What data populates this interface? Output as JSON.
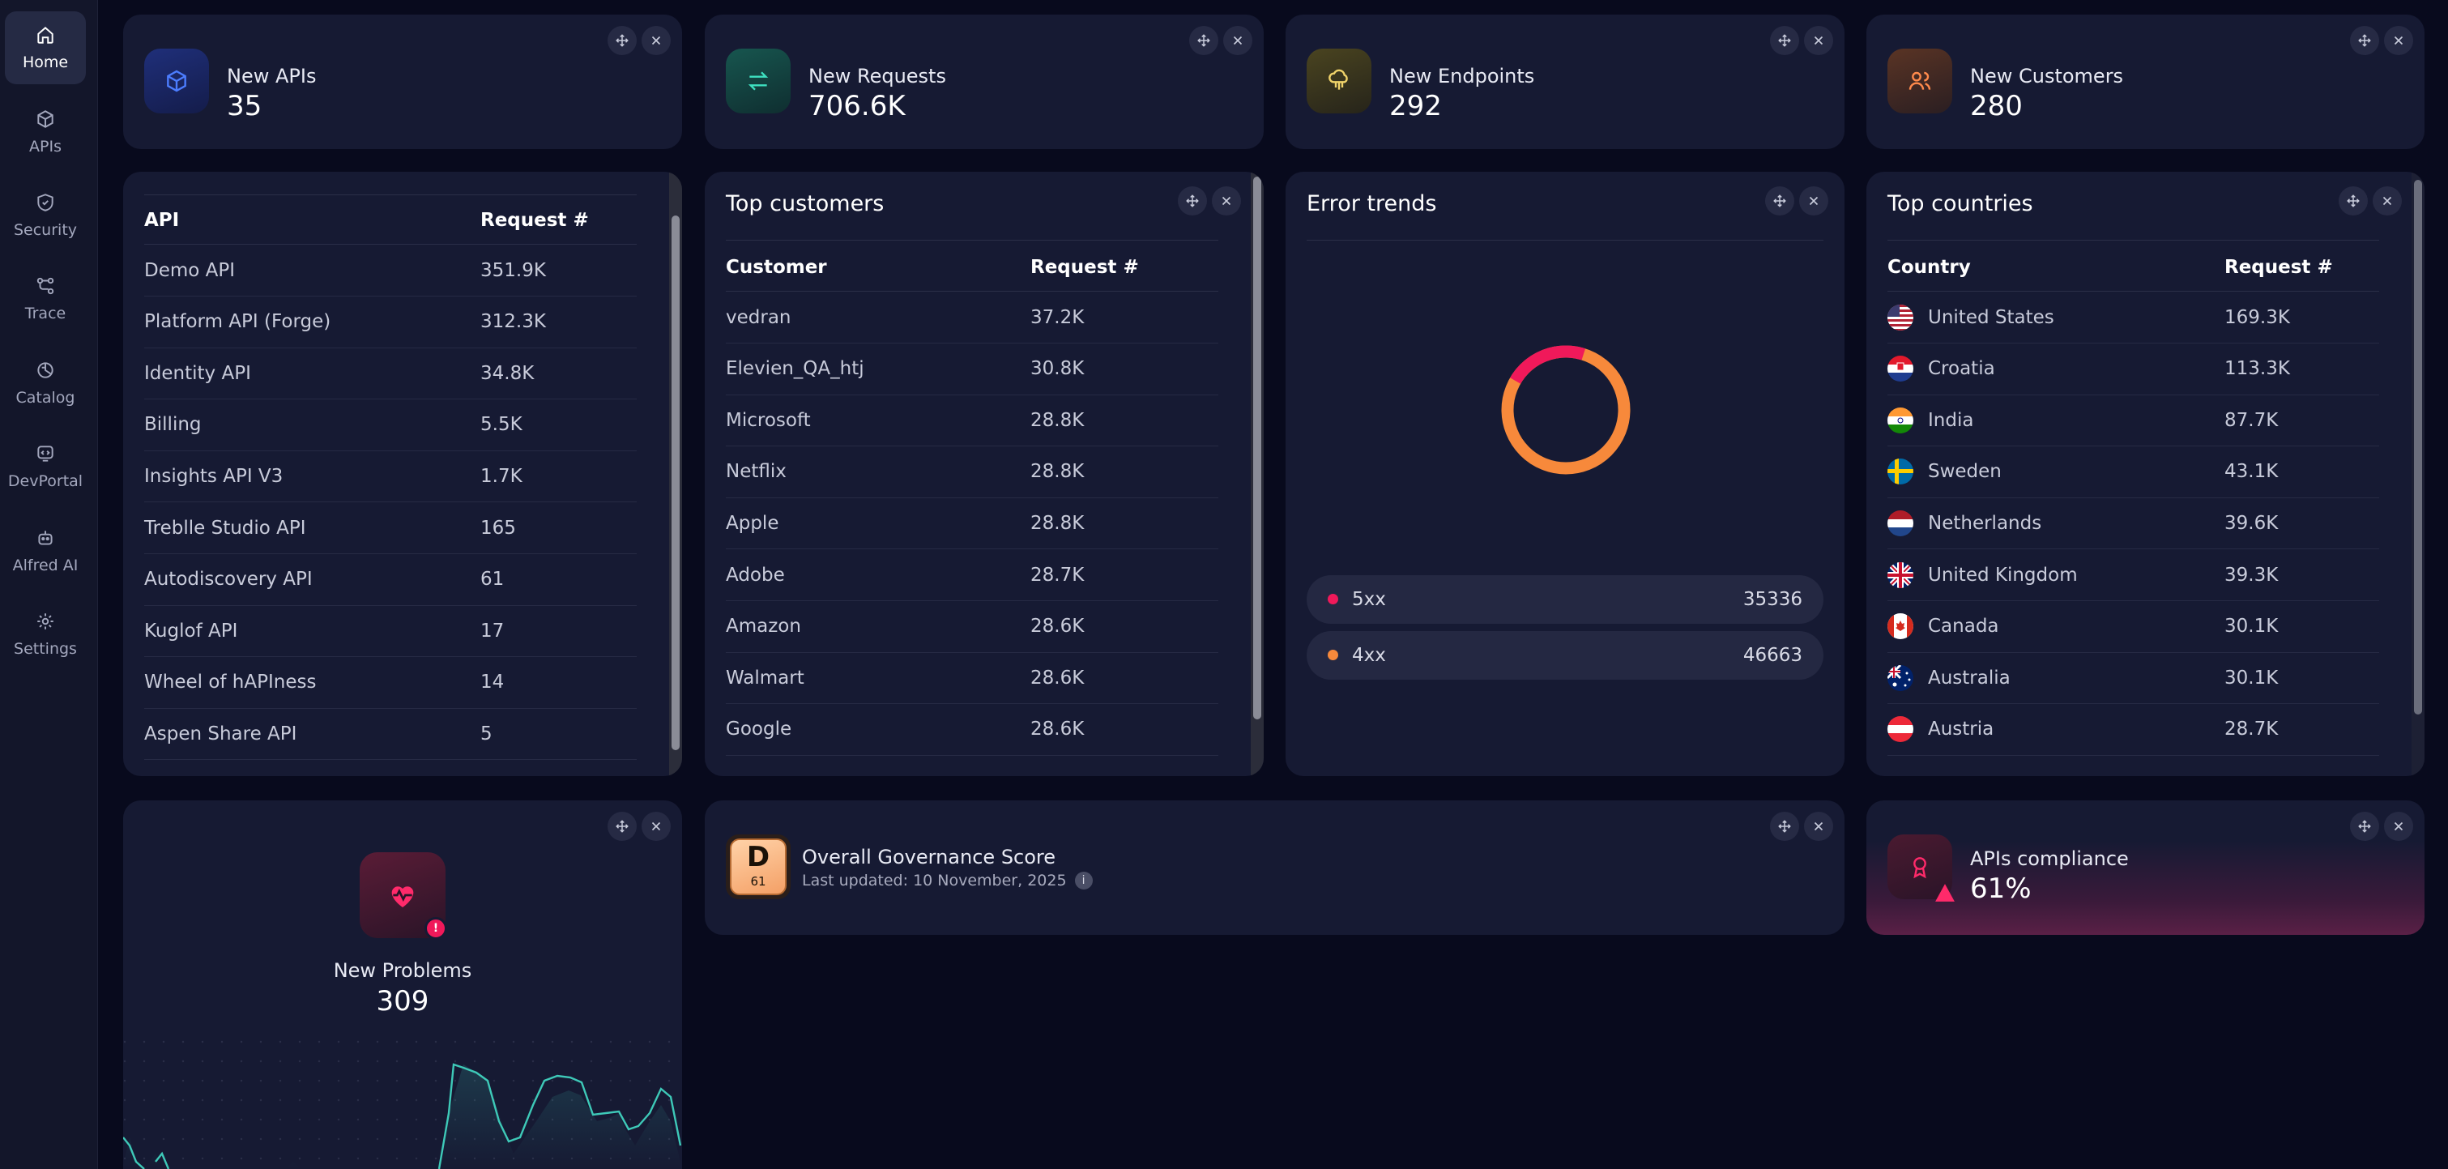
{
  "sidebar": {
    "items": [
      {
        "label": "Home",
        "icon": "home-icon"
      },
      {
        "label": "APIs",
        "icon": "cube-icon"
      },
      {
        "label": "Security",
        "icon": "shield-icon"
      },
      {
        "label": "Trace",
        "icon": "trace-icon"
      },
      {
        "label": "Catalog",
        "icon": "catalog-icon"
      },
      {
        "label": "DevPortal",
        "icon": "devportal-icon"
      },
      {
        "label": "Alfred AI",
        "icon": "robot-icon"
      },
      {
        "label": "Settings",
        "icon": "gear-icon"
      }
    ]
  },
  "stats": {
    "new_apis": {
      "label": "New APIs",
      "value": "35"
    },
    "new_requests": {
      "label": "New Requests",
      "value": "706.6K"
    },
    "new_endpoints": {
      "label": "New Endpoints",
      "value": "292"
    },
    "new_customers": {
      "label": "New Customers",
      "value": "280"
    }
  },
  "top_apis": {
    "col1": "API",
    "col2": "Request #",
    "rows": [
      {
        "name": "Demo API",
        "value": "351.9K"
      },
      {
        "name": "Platform API (Forge)",
        "value": "312.3K"
      },
      {
        "name": "Identity API",
        "value": "34.8K"
      },
      {
        "name": "Billing",
        "value": "5.5K"
      },
      {
        "name": "Insights API V3",
        "value": "1.7K"
      },
      {
        "name": "Treblle Studio API",
        "value": "165"
      },
      {
        "name": "Autodiscovery API",
        "value": "61"
      },
      {
        "name": "Kuglof API",
        "value": "17"
      },
      {
        "name": "Wheel of hAPIness",
        "value": "14"
      },
      {
        "name": "Aspen Share API",
        "value": "5"
      }
    ]
  },
  "top_customers": {
    "title": "Top customers",
    "col1": "Customer",
    "col2": "Request #",
    "rows": [
      {
        "name": "vedran",
        "value": "37.2K"
      },
      {
        "name": "Elevien_QA_htj",
        "value": "30.8K"
      },
      {
        "name": "Microsoft",
        "value": "28.8K"
      },
      {
        "name": "Netflix",
        "value": "28.8K"
      },
      {
        "name": "Apple",
        "value": "28.8K"
      },
      {
        "name": "Adobe",
        "value": "28.7K"
      },
      {
        "name": "Amazon",
        "value": "28.6K"
      },
      {
        "name": "Walmart",
        "value": "28.6K"
      },
      {
        "name": "Google",
        "value": "28.6K"
      }
    ]
  },
  "error_trends": {
    "title": "Error trends",
    "legend": [
      {
        "label": "5xx",
        "value": "35336",
        "color": "#f0195a"
      },
      {
        "label": "4xx",
        "value": "46663",
        "color": "#f7893b"
      }
    ]
  },
  "top_countries": {
    "title": "Top countries",
    "col1": "Country",
    "col2": "Request #",
    "rows": [
      {
        "name": "United States",
        "value": "169.3K",
        "flag": "us"
      },
      {
        "name": "Croatia",
        "value": "113.3K",
        "flag": "hr"
      },
      {
        "name": "India",
        "value": "87.7K",
        "flag": "in"
      },
      {
        "name": "Sweden",
        "value": "43.1K",
        "flag": "se"
      },
      {
        "name": "Netherlands",
        "value": "39.6K",
        "flag": "nl"
      },
      {
        "name": "United Kingdom",
        "value": "39.3K",
        "flag": "gb"
      },
      {
        "name": "Canada",
        "value": "30.1K",
        "flag": "ca"
      },
      {
        "name": "Australia",
        "value": "30.1K",
        "flag": "au"
      },
      {
        "name": "Austria",
        "value": "28.7K",
        "flag": "at"
      }
    ]
  },
  "problems": {
    "label": "New Problems",
    "value": "309",
    "badge": "!"
  },
  "governance": {
    "title": "Overall Governance Score",
    "updated": "Last updated: 10 November, 2025",
    "grade": "D",
    "score": "61"
  },
  "compliance": {
    "label": "APIs compliance",
    "value": "61%"
  },
  "colors": {
    "bg": "#080a1d",
    "card": "#161a33",
    "accent_red": "#f0195a",
    "accent_orange": "#f7893b",
    "teal": "#3ec9b8"
  }
}
